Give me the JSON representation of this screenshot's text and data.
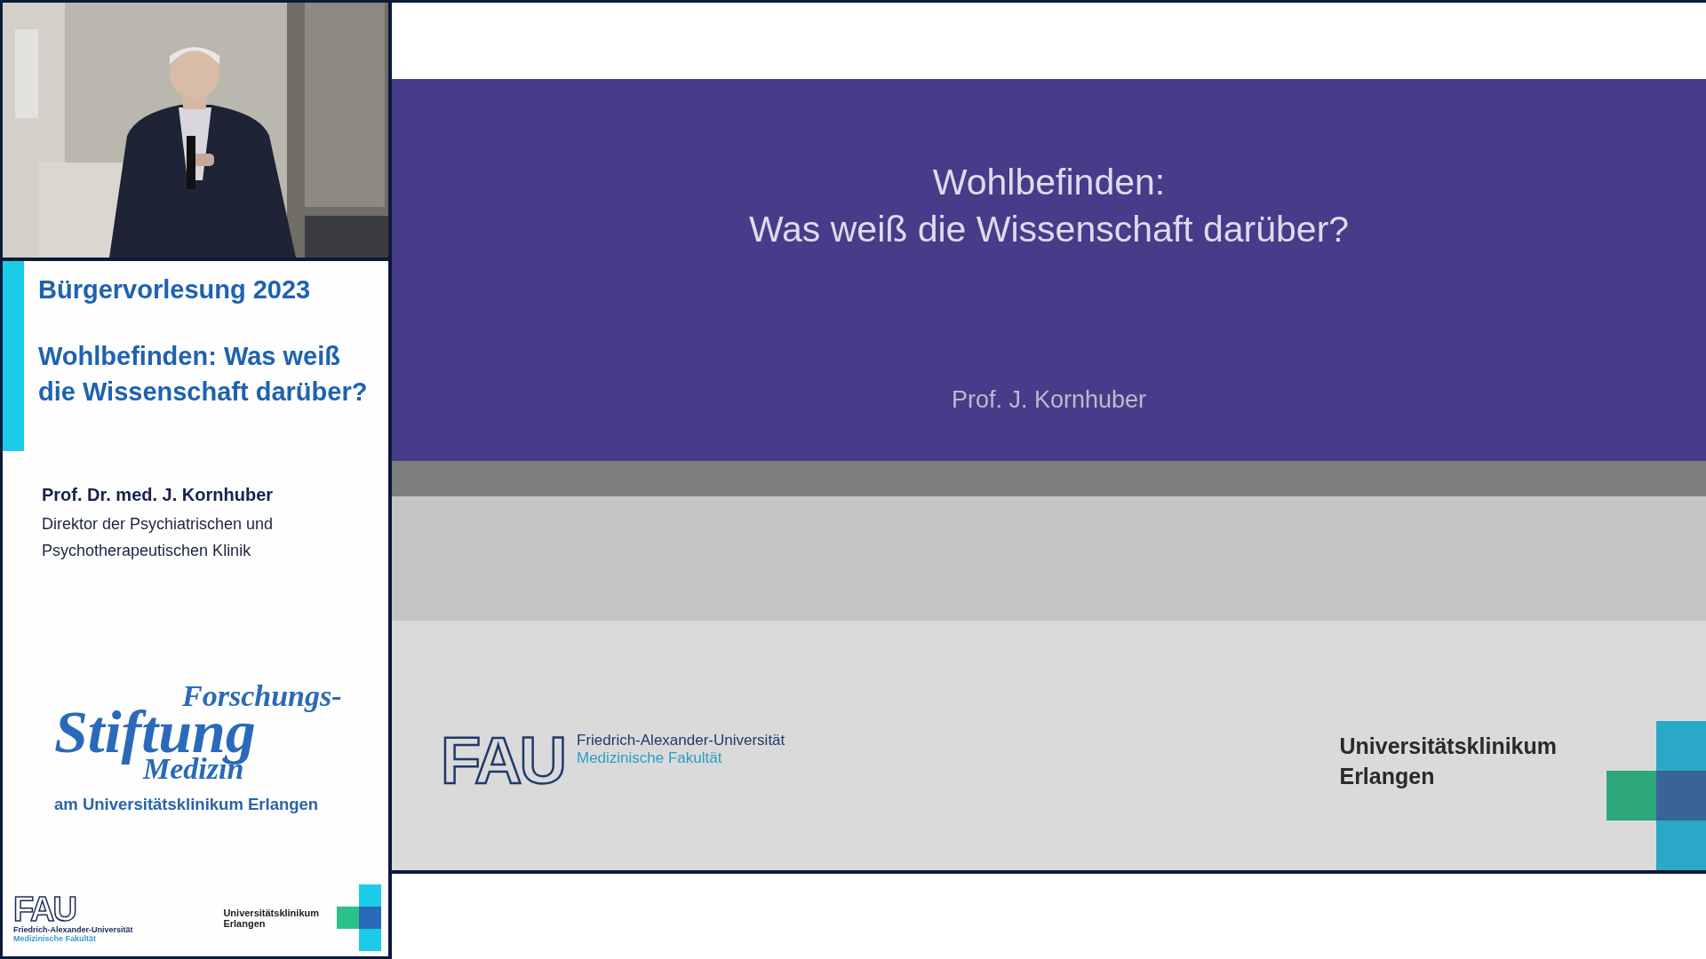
{
  "info_panel": {
    "series_title": "Bürgervorlesung 2023",
    "lecture_title_lines": [
      "Wohlbefinden: Was weiß",
      "die Wissenschaft darüber?"
    ],
    "speaker": "Prof. Dr. med. J. Kornhuber",
    "speaker_role_lines": [
      "Direktor der Psychiatrischen und",
      "Psychotherapeutischen Klinik"
    ],
    "foundation_logo": {
      "line_1": "Forschungs-",
      "line_2": "Stiftung",
      "line_3": "Medizin",
      "subtitle": "am Universitätsklinikum Erlangen"
    },
    "footer": {
      "fau_logo": "FAU",
      "fau_name": "Friedrich-Alexander-Universität",
      "fau_faculty": "Medizinische Fakultät",
      "clinic_name_lines": [
        "Universitätsklinikum",
        "Erlangen"
      ]
    }
  },
  "slide": {
    "title_lines": [
      "Wohlbefinden:",
      "Was weiß die Wissenschaft darüber?"
    ],
    "author": "Prof. J. Kornhuber",
    "footer": {
      "fau_logo": "FAU",
      "fau_name": "Friedrich-Alexander-Universität",
      "fau_faculty": "Medizinische Fakultät",
      "clinic_name_lines": [
        "Universitätsklinikum",
        "Erlangen"
      ]
    }
  }
}
